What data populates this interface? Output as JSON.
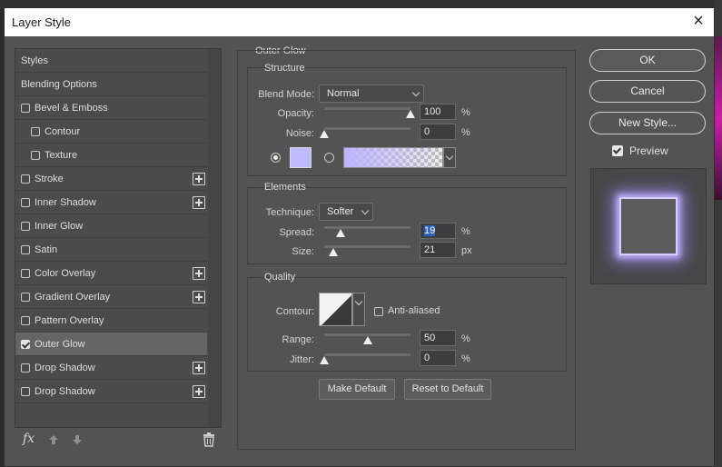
{
  "dialog": {
    "title": "Layer Style",
    "close_glyph": "×"
  },
  "style_list": {
    "items": [
      {
        "label": "Styles",
        "checkbox": false,
        "checked": false,
        "plus": false,
        "indent": false
      },
      {
        "label": "Blending Options",
        "checkbox": false,
        "checked": false,
        "plus": false,
        "indent": false
      },
      {
        "label": "Bevel & Emboss",
        "checkbox": true,
        "checked": false,
        "plus": false,
        "indent": false
      },
      {
        "label": "Contour",
        "checkbox": true,
        "checked": false,
        "plus": false,
        "indent": true
      },
      {
        "label": "Texture",
        "checkbox": true,
        "checked": false,
        "plus": false,
        "indent": true
      },
      {
        "label": "Stroke",
        "checkbox": true,
        "checked": false,
        "plus": true,
        "indent": false
      },
      {
        "label": "Inner Shadow",
        "checkbox": true,
        "checked": false,
        "plus": true,
        "indent": false
      },
      {
        "label": "Inner Glow",
        "checkbox": true,
        "checked": false,
        "plus": false,
        "indent": false
      },
      {
        "label": "Satin",
        "checkbox": true,
        "checked": false,
        "plus": false,
        "indent": false
      },
      {
        "label": "Color Overlay",
        "checkbox": true,
        "checked": false,
        "plus": true,
        "indent": false
      },
      {
        "label": "Gradient Overlay",
        "checkbox": true,
        "checked": false,
        "plus": true,
        "indent": false
      },
      {
        "label": "Pattern Overlay",
        "checkbox": true,
        "checked": false,
        "plus": false,
        "indent": false
      },
      {
        "label": "Outer Glow",
        "checkbox": true,
        "checked": true,
        "plus": false,
        "indent": false,
        "selected": true
      },
      {
        "label": "Drop Shadow",
        "checkbox": true,
        "checked": false,
        "plus": true,
        "indent": false
      },
      {
        "label": "Drop Shadow",
        "checkbox": true,
        "checked": false,
        "plus": true,
        "indent": false
      }
    ],
    "fx_label": "fx"
  },
  "outer_glow": {
    "title": "Outer Glow",
    "structure": {
      "title": "Structure",
      "blend_mode_label": "Blend Mode:",
      "blend_mode_value": "Normal",
      "opacity_label": "Opacity:",
      "opacity_value": "100",
      "opacity_unit": "%",
      "opacity_level": 1.0,
      "noise_label": "Noise:",
      "noise_value": "0",
      "noise_unit": "%",
      "noise_level": 0.0,
      "glow_color": "#bfbaff"
    },
    "elements": {
      "title": "Elements",
      "technique_label": "Technique:",
      "technique_value": "Softer",
      "spread_label": "Spread:",
      "spread_value": "19",
      "spread_unit": "%",
      "spread_level": 0.19,
      "size_label": "Size:",
      "size_value": "21",
      "size_unit": "px",
      "size_level": 0.1
    },
    "quality": {
      "title": "Quality",
      "contour_label": "Contour:",
      "anti_aliased_label": "Anti-aliased",
      "range_label": "Range:",
      "range_value": "50",
      "range_unit": "%",
      "range_level": 0.5,
      "jitter_label": "Jitter:",
      "jitter_value": "0",
      "jitter_unit": "%",
      "jitter_level": 0.0
    },
    "make_default_label": "Make Default",
    "reset_default_label": "Reset to Default"
  },
  "actions": {
    "ok_label": "OK",
    "cancel_label": "Cancel",
    "new_style_label": "New Style...",
    "preview_label": "Preview",
    "preview_checked": true
  }
}
